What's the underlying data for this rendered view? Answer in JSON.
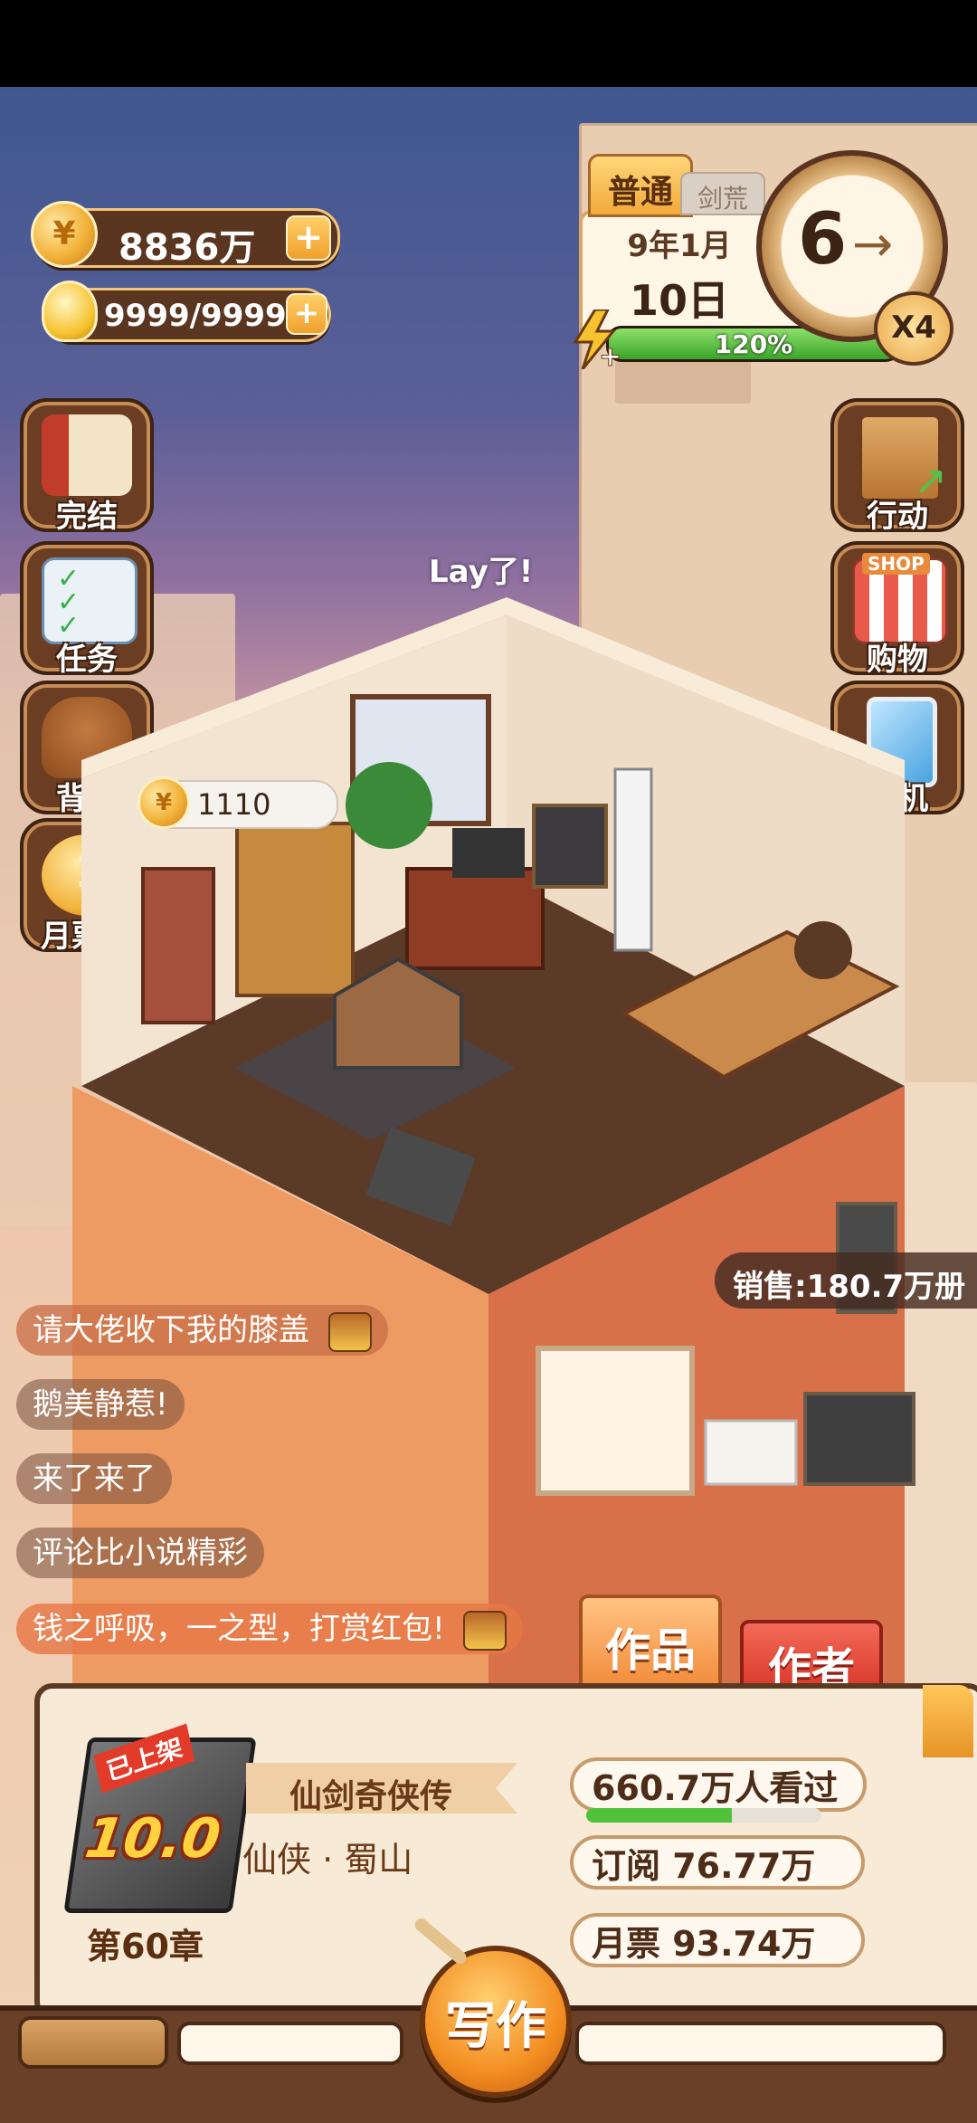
{
  "currency": {
    "coins": "8836万",
    "energy": "9999/9999"
  },
  "date_panel": {
    "mode": "普通",
    "mode_alt": "剑荒",
    "year_month": "9年1月",
    "day": "10日",
    "progress_percent": "120%",
    "progress_fraction": 1.0,
    "clock_number": "6",
    "speed": "X4"
  },
  "left_menu": [
    {
      "label": "完结",
      "icon": "book-icon"
    },
    {
      "label": "任务",
      "icon": "checklist-icon"
    },
    {
      "label": "背包",
      "icon": "bag-icon"
    },
    {
      "label": "月票榜",
      "icon": "ticket-icon"
    }
  ],
  "right_menu": [
    {
      "label": "行动",
      "icon": "door-icon"
    },
    {
      "label": "购物",
      "icon": "shop-icon"
    },
    {
      "label": "手机",
      "icon": "phone-icon"
    }
  ],
  "shop_sign": "SHOP",
  "room": {
    "speech": "Lay了!",
    "coin_bubble": "1110"
  },
  "sales": "销售:180.7万册",
  "chat_messages": [
    "请大佬收下我的膝盖",
    "鹅美静惹!",
    "来了来了",
    "评论比小说精彩",
    "钱之呼吸，一之型，打赏红包!"
  ],
  "tabs": {
    "works": "作品",
    "author": "作者"
  },
  "book": {
    "status_tag": "已上架",
    "score": "10.0",
    "title": "仙剑奇侠传",
    "genre": "仙侠 · 蜀山",
    "chapter": "第60章",
    "viewers": "660.7万人看过",
    "viewers_fraction": 0.62,
    "subscriptions": "订阅  76.77万",
    "monthly_tickets": "月票  93.74万"
  },
  "write_button": "写作",
  "colors": {
    "panel_bg": "#f7ead6",
    "panel_border": "#5b3a24",
    "accent_orange": "#f0a12c",
    "author_red": "#e64a3b",
    "progress_green": "#4fc23a"
  }
}
